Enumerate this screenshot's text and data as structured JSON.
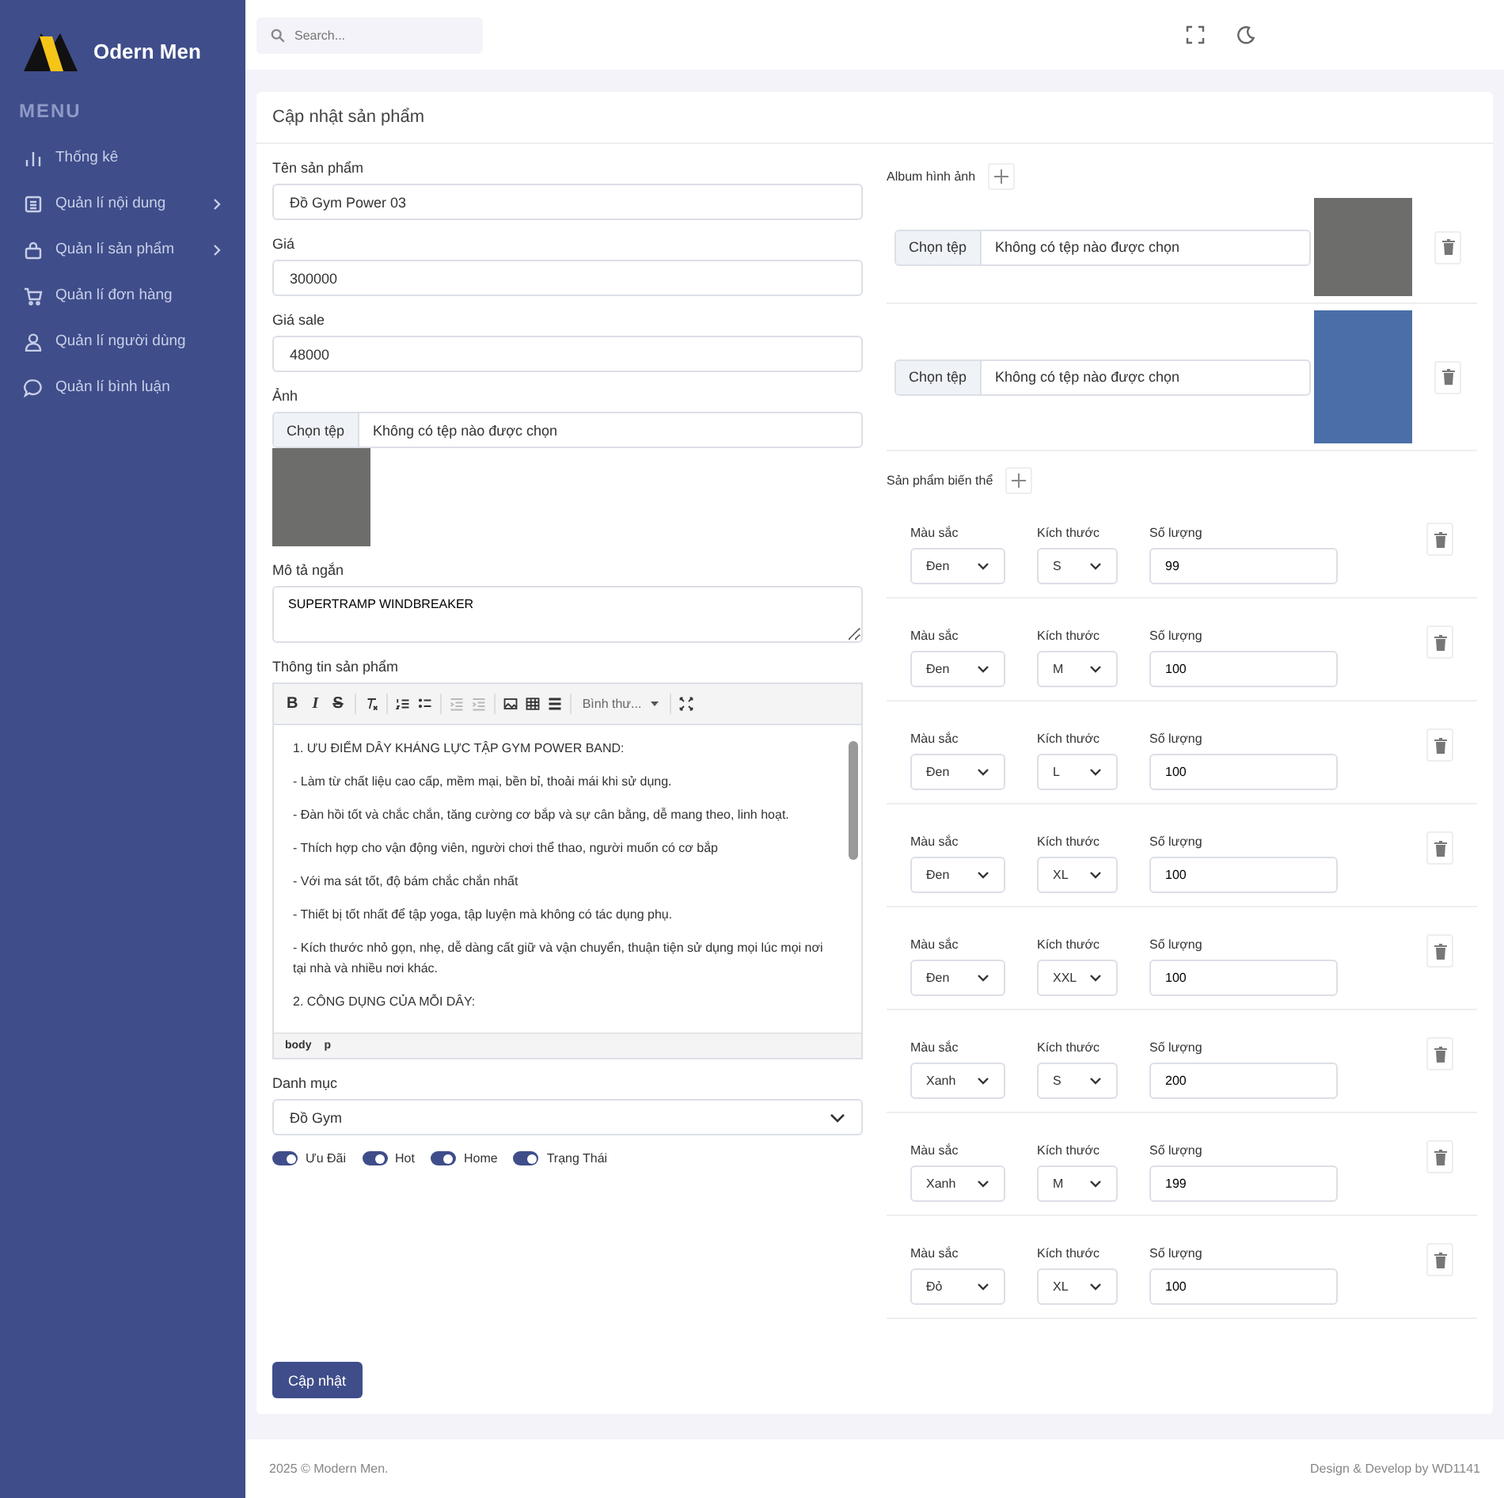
{
  "sidebar": {
    "brand": "Odern Men",
    "menu_title": "MENU",
    "items": [
      {
        "label": "Thống kê",
        "kind": "chart",
        "expandable": false
      },
      {
        "label": "Quản lí nội dung",
        "kind": "doc",
        "expandable": true
      },
      {
        "label": "Quản lí sản phẩm",
        "kind": "bag",
        "expandable": true
      },
      {
        "label": "Quản lí đơn hàng",
        "kind": "cart",
        "expandable": false
      },
      {
        "label": "Quản lí người dùng",
        "kind": "user",
        "expandable": false
      },
      {
        "label": "Quản lí bình luận",
        "kind": "chat",
        "expandable": false
      }
    ]
  },
  "topbar": {
    "search": {
      "placeholder": "Search..."
    }
  },
  "card_title": "Cập nhật sản phẩm",
  "fields": [
    {
      "label": "Tên sản phẩm",
      "value": "Đồ Gym Power 03"
    },
    {
      "label": "Giá",
      "value": "300000"
    },
    {
      "label": "Giá sale",
      "value": "48000"
    }
  ],
  "image": {
    "label": "Ảnh",
    "button": "Chọn tệp",
    "file_text": "Không có tệp nào được chọn"
  },
  "short_desc": {
    "label": "Mô tả ngắn",
    "value": "SUPERTRAMP WINDBREAKER"
  },
  "editor": {
    "label": "Thông tin sản phẩm",
    "toolbar": [
      {
        "kind": "text",
        "text": "B",
        "disabled": false
      },
      {
        "kind": "text",
        "text": "I",
        "disabled": false
      },
      {
        "kind": "text",
        "text": "S",
        "disabled": false
      },
      {
        "kind": "clear",
        "disabled": false
      },
      {
        "kind": "ol",
        "disabled": false
      },
      {
        "kind": "ul",
        "disabled": false
      },
      {
        "kind": "outdent",
        "disabled": true
      },
      {
        "kind": "indent",
        "disabled": true
      },
      {
        "kind": "image",
        "disabled": false
      },
      {
        "kind": "table",
        "disabled": false
      },
      {
        "kind": "rule",
        "disabled": false
      },
      {
        "kind": "format",
        "text": "Bình thư...",
        "disabled": false
      },
      {
        "kind": "maximize",
        "disabled": false
      }
    ],
    "paragraphs": [
      "1. ƯU ĐIỂM DÂY KHÁNG LỰC TẬP GYM POWER BAND:",
      "- Làm từ chất liệu cao cấp, mềm mại, bền bỉ, thoải mái khi sử dụng.",
      "- Đàn hồi tốt và chắc chắn, tăng cường cơ bắp và sự cân bằng, dễ mang theo, linh hoạt.",
      "- Thích hợp cho vận động viên, người chơi thể thao, người muốn có cơ bắp",
      "- Với ma sát tốt, độ bám chắc chắn nhất",
      "- Thiết bị tốt nhất để tập yoga, tập luyện mà không có tác dụng phụ.",
      "- Kích thước nhỏ gọn, nhẹ, dễ dàng cất giữ và vận chuyển, thuận tiện sử dụng mọi lúc mọi nơi tại nhà và nhiều nơi khác.",
      "2. CÔNG DỤNG CỦA MỖI DÂY:"
    ],
    "path": [
      "body",
      "p"
    ]
  },
  "category": {
    "label": "Danh mục",
    "value": "Đồ Gym"
  },
  "toggles": [
    {
      "label": "Ưu Đãi",
      "on": true
    },
    {
      "label": "Hot",
      "on": true
    },
    {
      "label": "Home",
      "on": true
    },
    {
      "label": "Trạng Thái",
      "on": true
    }
  ],
  "submit": "Cập nhật",
  "album": {
    "label": "Album hình ảnh",
    "items": [
      {
        "button": "Chọn tệp",
        "file_text": "Không có tệp nào được chọn"
      },
      {
        "button": "Chọn tệp",
        "file_text": "Không có tệp nào được chọn"
      }
    ]
  },
  "variants": {
    "label": "Sản phẩm biến thể",
    "rows": [
      {
        "color_label": "Màu sắc",
        "color_option": "Đen",
        "size_label": "Kích thước",
        "size": "S",
        "qty_label": "Số lượng",
        "qty": "99"
      },
      {
        "color_label": "Màu sắc",
        "color_option": "Đen",
        "size_label": "Kích thước",
        "size": "M",
        "qty_label": "Số lượng",
        "qty": "100"
      },
      {
        "color_label": "Màu sắc",
        "color_option": "Đen",
        "size_label": "Kích thước",
        "size": "L",
        "qty_label": "Số lượng",
        "qty": "100"
      },
      {
        "color_label": "Màu sắc",
        "color_option": "Đen",
        "size_label": "Kích thước",
        "size": "XL",
        "qty_label": "Số lượng",
        "qty": "100"
      },
      {
        "color_label": "Màu sắc",
        "color_option": "Đen",
        "size_label": "Kích thước",
        "size": "XXL",
        "qty_label": "Số lượng",
        "qty": "100"
      },
      {
        "color_label": "Màu sắc",
        "color_option": "Xanh",
        "size_label": "Kích thước",
        "size": "S",
        "qty_label": "Số lượng",
        "qty": "200"
      },
      {
        "color_label": "Màu sắc",
        "color_option": "Xanh",
        "size_label": "Kích thước",
        "size": "M",
        "qty_label": "Số lượng",
        "qty": "199"
      },
      {
        "color_label": "Màu sắc",
        "color_option": "Đỏ",
        "size_label": "Kích thước",
        "size": "XL",
        "qty_label": "Số lượng",
        "qty": "100"
      }
    ]
  },
  "footer": {
    "left": "2025 © Modern Men.",
    "right": "Design & Develop by WD1141"
  }
}
